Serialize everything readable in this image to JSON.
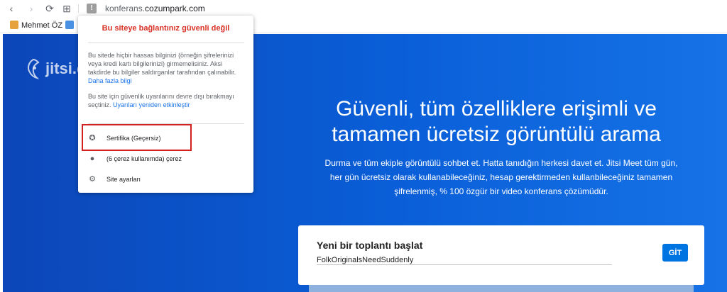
{
  "browser": {
    "back_glyph": "‹",
    "forward_glyph": "›",
    "reload_glyph": "⟳",
    "tabs_glyph": "⊞",
    "warning_glyph": "!",
    "url_prefix": "konferans.",
    "url_domain": "cozumpark.com"
  },
  "bookmarks": [
    {
      "label": "Mehmet ÖZ",
      "icon": "cat-icon",
      "color": "#e6a23c"
    },
    {
      "label": "",
      "icon": "app-icon",
      "color": "#4a90e2"
    }
  ],
  "security_popup": {
    "title": "Bu siteye bağlantınız güvenli değil",
    "warning_text": "Bu sitede hiçbir hassas bilginizi (örneğin şifrelerinizi veya kredi kartı bilgilerinizi) girmemelisiniz. Aksi takdirde bu bilgiler saldırganlar tarafından çalınabilir.",
    "learn_more": "Daha fazla bilgi",
    "disabled_text": "Bu site için güvenlik uyarılarını devre dışı bırakmayı seçtiniz.",
    "reenable_link": "Uyarıları yeniden etkinleştir",
    "certificate": "Sertifika (Geçersiz)",
    "cookies": "(6 çerez kullanımda) çerez",
    "site_settings": "Site ayarları"
  },
  "page": {
    "logo_text": "jitsi.c",
    "hero_title": "Güvenli, tüm özelliklere erişimli ve tamamen ücretsiz görüntülü arama",
    "hero_subtitle": "Durma ve tüm ekiple görüntülü sohbet et. Hatta tanıdığın herkesi davet et. Jitsi Meet tüm gün, her gün ücretsiz olarak kullanabileceğiniz, hesap gerektirmeden kullanbileceğiniz tamamen şifrelenmiş, % 100 özgür bir video konferans çözümüdür.",
    "start_meeting_title": "Yeni bir toplantı başlat",
    "meeting_name_value": "FolkOriginalsNeedSuddenly",
    "go_button": "GİT"
  },
  "colors": {
    "accent": "#0074e0",
    "warning": "#d93025",
    "highlight": "#d32020"
  }
}
